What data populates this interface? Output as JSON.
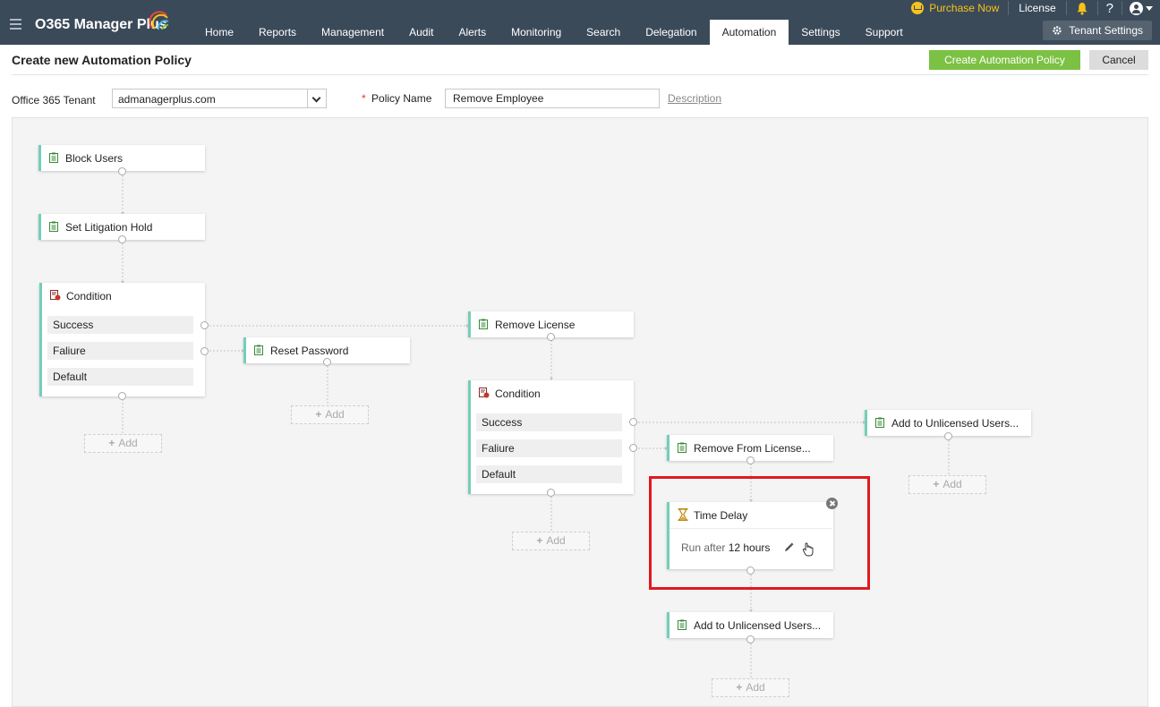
{
  "app": {
    "name": "O365 Manager Plus"
  },
  "nav": {
    "items": [
      "Home",
      "Reports",
      "Management",
      "Audit",
      "Alerts",
      "Monitoring",
      "Search",
      "Delegation",
      "Automation",
      "Settings",
      "Support"
    ],
    "active": "Automation"
  },
  "topbar": {
    "purchase_now": "Purchase Now",
    "license": "License",
    "help": "?",
    "tenant_settings": "Tenant Settings"
  },
  "header": {
    "title": "Create new Automation Policy",
    "create_button": "Create Automation Policy",
    "cancel_button": "Cancel"
  },
  "form": {
    "tenant_label": "Office 365 Tenant",
    "tenant_value": "admanagerplus.com",
    "policy_required_mark": "*",
    "policy_name_label": "Policy Name",
    "policy_name_value": "Remove Employee",
    "description_link": "Description"
  },
  "workflow": {
    "nodes": {
      "block_users": "Block Users",
      "set_litigation_hold": "Set Litigation Hold",
      "reset_password": "Reset Password",
      "remove_license": "Remove License",
      "remove_from_license": "Remove From License...",
      "add_unlicensed_1": "Add to Unlicensed Users...",
      "add_unlicensed_2": "Add to Unlicensed Users..."
    },
    "condition_1": {
      "title": "Condition",
      "branches": [
        "Success",
        "Faliure",
        "Default"
      ]
    },
    "condition_2": {
      "title": "Condition",
      "branches": [
        "Success",
        "Faliure",
        "Default"
      ]
    },
    "time_delay": {
      "title": "Time Delay",
      "run_after_label": "Run after",
      "value": "12 hours"
    },
    "add_label": "Add"
  },
  "colors": {
    "topbar": "#3b4a59",
    "accent_green": "#7bc143",
    "node_border": "#74ceb8",
    "highlight": "#e0191f",
    "purchase": "#f7c21a"
  },
  "icons": [
    "hamburger-icon",
    "cart-icon",
    "bell-icon",
    "help-icon",
    "user-icon",
    "gear-icon",
    "dropdown-caret-icon",
    "action-doc-icon",
    "condition-icon",
    "hourglass-icon",
    "edit-pencil-icon",
    "close-icon",
    "hand-cursor-icon",
    "plus-icon"
  ]
}
